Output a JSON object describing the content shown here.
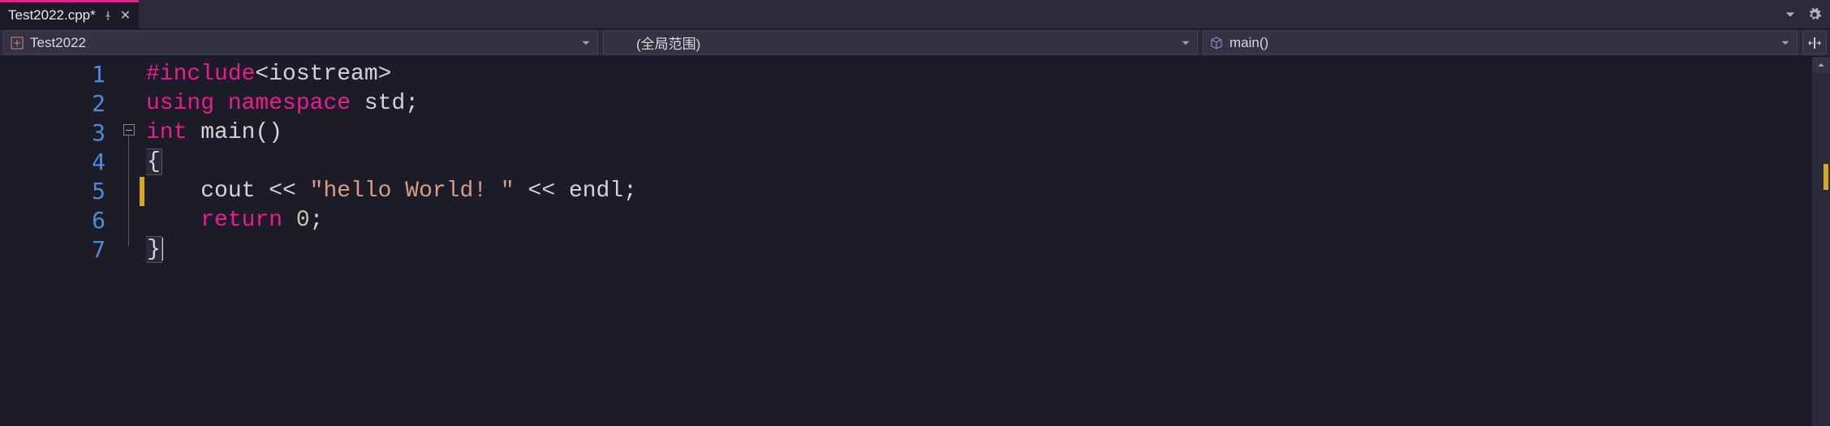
{
  "tab": {
    "filename": "Test2022.cpp*"
  },
  "nav": {
    "project": "Test2022",
    "scope": "(全局范围)",
    "member": "main()"
  },
  "lines": [
    "1",
    "2",
    "3",
    "4",
    "5",
    "6",
    "7"
  ],
  "code": {
    "l1": {
      "include": "#include",
      "header": "<iostream>"
    },
    "l2": {
      "using": "using",
      "namespace_kw": "namespace",
      "ns": "std",
      "semi": ";"
    },
    "l3": {
      "type": "int",
      "fn": "main",
      "paren": "()"
    },
    "l4": {
      "brace": "{"
    },
    "l5": {
      "cout": "cout",
      "op1": "<<",
      "str": "\"hello World! \"",
      "op2": "<<",
      "endl": "endl",
      "semi": ";"
    },
    "l6": {
      "return": "return",
      "zero": "0",
      "semi": ";"
    },
    "l7": {
      "brace": "}"
    }
  }
}
